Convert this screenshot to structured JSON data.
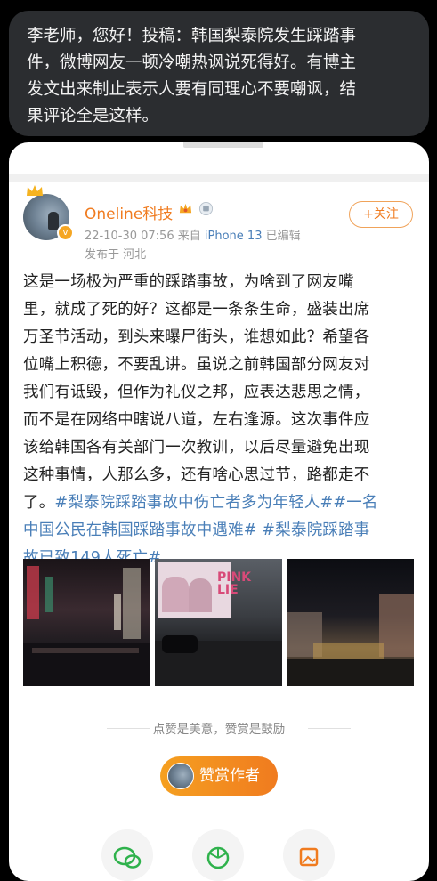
{
  "message": {
    "lines": [
      "李老师，您好！投稿：韩国梨泰院发生踩踏事",
      "件，微博网友一顿冷嘲热讽说死得好。有博主",
      "发文出来制止表示人要有同理心不要嘲讽，结",
      "果评论全是这样。"
    ]
  },
  "post": {
    "author": "Oneline科技",
    "timestamp": "22-10-30 07:56",
    "source_prefix": "来自",
    "device": "iPhone 13",
    "edited": "已编辑",
    "location": "发布于 河北",
    "follow_label": "+关注",
    "body_lines": [
      "这是一场极为严重的踩踏事故，为啥到了网友嘴",
      "里，就成了死的好？这都是一条条生命，盛装出席",
      "万圣节活动，到头来曝尸街头，谁想如此？希望各",
      "位嘴上积德，不要乱讲。虽说之前韩国部分网友对",
      "我们有诋毁，但作为礼仪之邦，应表达悲思之情，",
      "而不是在网络中瞎说八道，左右逢源。这次事件应",
      "该给韩国各有关部门一次教训，以后尽量避免出现",
      "这种事情，人那么多，还有啥心思过节，路都走不"
    ],
    "last_line_plain": "了。",
    "hashtag_line1": "#梨泰院踩踏事故中伤亡者多为年轻人##一名",
    "hashtag_line2": "中国公民在韩国踩踏事故中遇难# #梨泰院踩踏事",
    "hashtag_line3": "故已致149人死亡#",
    "praise_text": "点赞是美意，赞赏是鼓励",
    "reward_label": "赞赏作者",
    "photo2_sign": "PINK LIE"
  },
  "colors": {
    "accent": "#f07b1f",
    "link": "#4a7fb8",
    "bubble": "#2b2d30"
  }
}
